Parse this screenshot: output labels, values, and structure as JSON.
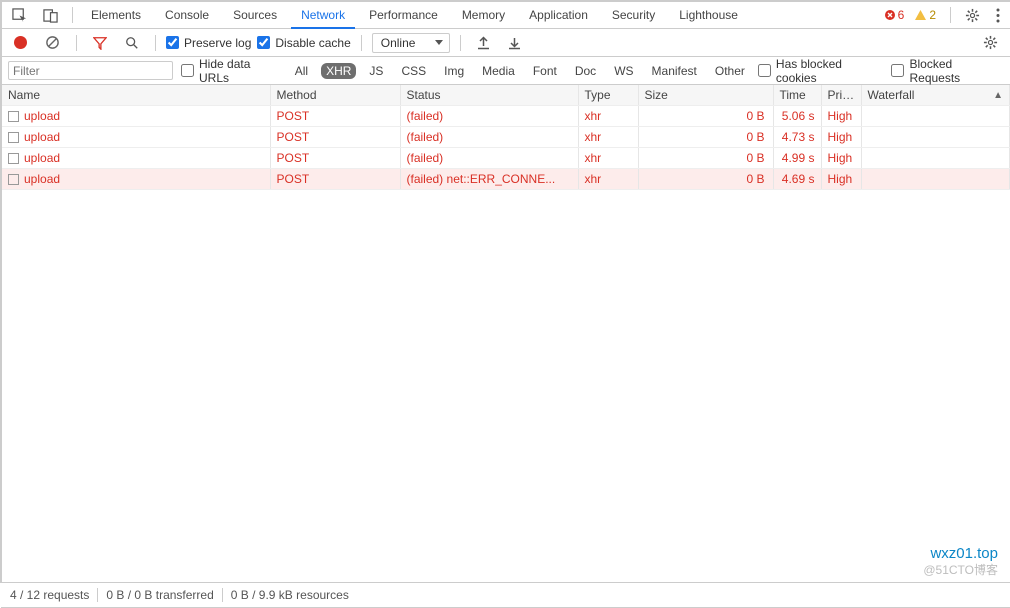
{
  "tabs": {
    "elements": "Elements",
    "console": "Console",
    "sources": "Sources",
    "network": "Network",
    "performance": "Performance",
    "memory": "Memory",
    "application": "Application",
    "security": "Security",
    "lighthouse": "Lighthouse"
  },
  "badges": {
    "errors": "6",
    "warnings": "2"
  },
  "toolbar": {
    "preserve_log": "Preserve log",
    "disable_cache": "Disable cache",
    "throttle_label": "Online"
  },
  "filter": {
    "placeholder": "Filter",
    "hide_data_urls": "Hide data URLs",
    "types": {
      "all": "All",
      "xhr": "XHR",
      "js": "JS",
      "css": "CSS",
      "img": "Img",
      "media": "Media",
      "font": "Font",
      "doc": "Doc",
      "ws": "WS",
      "manifest": "Manifest",
      "other": "Other"
    },
    "has_blocked_cookies": "Has blocked cookies",
    "blocked_requests": "Blocked Requests"
  },
  "columns": {
    "name": "Name",
    "method": "Method",
    "status": "Status",
    "type": "Type",
    "size": "Size",
    "time": "Time",
    "priority": "Prior...",
    "waterfall": "Waterfall"
  },
  "requests": [
    {
      "name": "upload",
      "method": "POST",
      "status": "(failed)",
      "type": "xhr",
      "size": "0 B",
      "time": "5.06 s",
      "priority": "High"
    },
    {
      "name": "upload",
      "method": "POST",
      "status": "(failed)",
      "type": "xhr",
      "size": "0 B",
      "time": "4.73 s",
      "priority": "High"
    },
    {
      "name": "upload",
      "method": "POST",
      "status": "(failed)",
      "type": "xhr",
      "size": "0 B",
      "time": "4.99 s",
      "priority": "High"
    },
    {
      "name": "upload",
      "method": "POST",
      "status": "(failed) net::ERR_CONNE...",
      "type": "xhr",
      "size": "0 B",
      "time": "4.69 s",
      "priority": "High"
    }
  ],
  "status": {
    "requests": "4 / 12 requests",
    "transferred": "0 B / 0 B transferred",
    "resources": "0 B / 9.9 kB resources"
  },
  "watermark": {
    "line1": "wxz01.top",
    "line2": "@51CTO博客"
  }
}
